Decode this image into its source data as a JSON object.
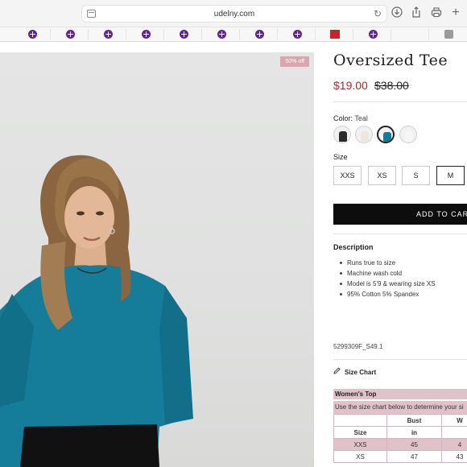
{
  "browser": {
    "url": "udelny.com"
  },
  "product": {
    "badge": "50% off",
    "title": "Oversized Tee",
    "sale_price": "$19.00",
    "original_price": "$38.00",
    "color_label": "Color:",
    "color_value": "Teal",
    "swatches": [
      {
        "name": "Black",
        "color": "#2a2a2a"
      },
      {
        "name": "Cream",
        "color": "#ede6df"
      },
      {
        "name": "Teal",
        "color": "#137a9a"
      },
      {
        "name": "White",
        "color": "#f6f6f6"
      }
    ],
    "size_label": "Size",
    "sizes": [
      "XXS",
      "XS",
      "S",
      "M"
    ],
    "selected_size": "M",
    "add_to_cart": "ADD TO CART",
    "description_title": "Description",
    "description_items": [
      "Runs true to size",
      "Machine wash cold",
      "Model is 5'9 & wearing size XS",
      " 95% Cotton 5% Spandex"
    ],
    "sku": "5299309F_S49.1",
    "size_chart_label": "Size Chart"
  },
  "size_table": {
    "title": "Women's Top",
    "note": "Use the size chart below to determine your si",
    "rows": [
      [
        "",
        "Bust",
        "W"
      ],
      [
        "Size",
        "in",
        ""
      ],
      [
        "XXS",
        "45",
        "4"
      ],
      [
        "XS",
        "47",
        "43"
      ]
    ]
  }
}
